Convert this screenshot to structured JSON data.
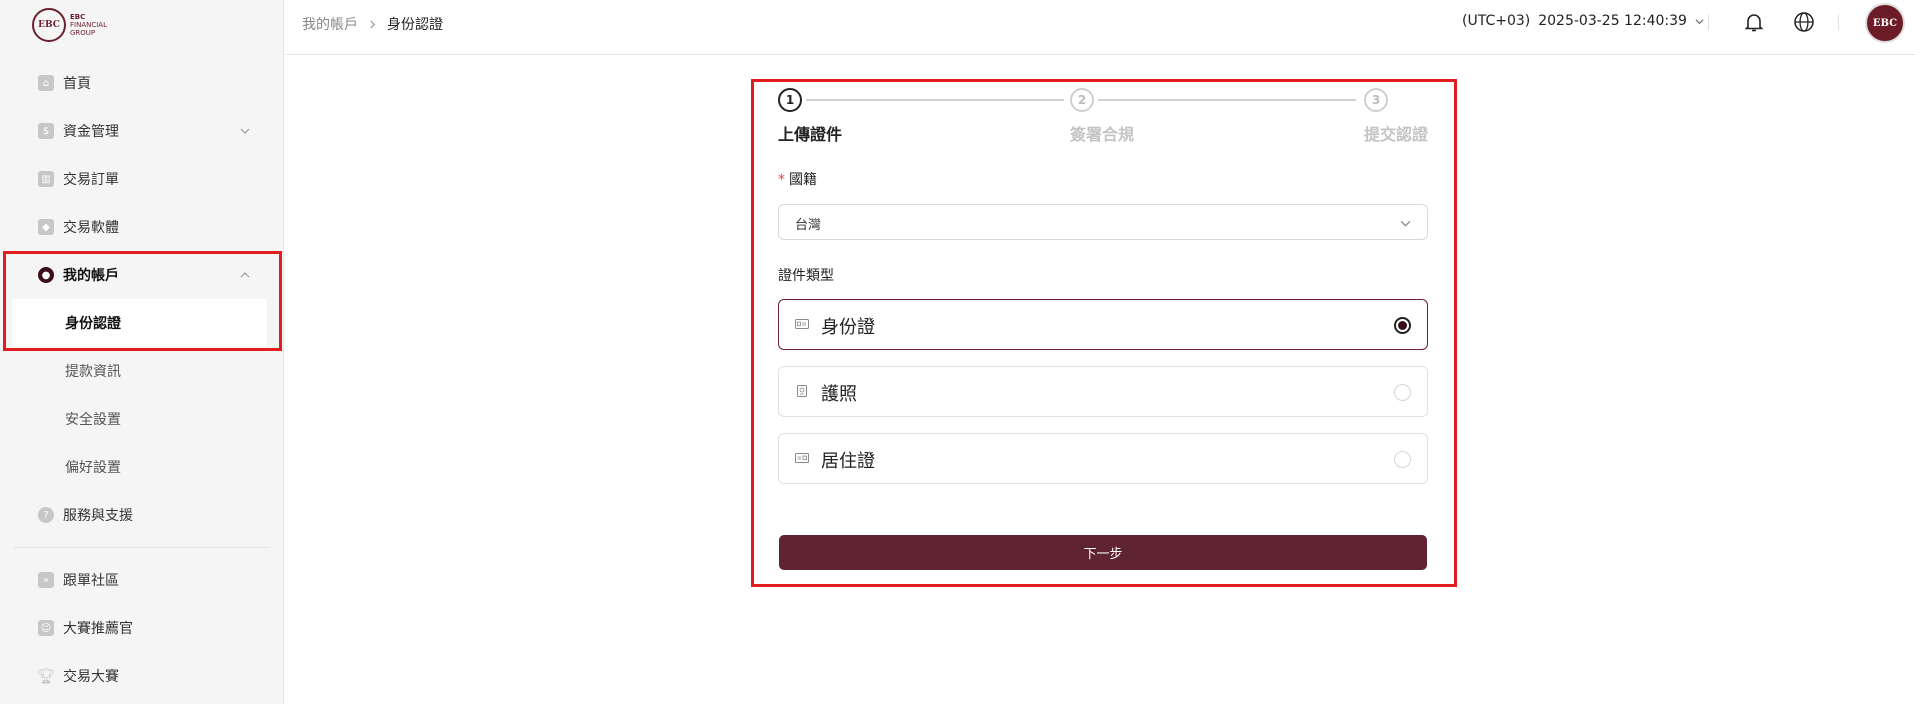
{
  "brand": {
    "short": "EBC",
    "line1": "EBC",
    "line2": "FINANCIAL",
    "line3": "GROUP"
  },
  "sidebar": {
    "items": [
      {
        "label": "首頁"
      },
      {
        "label": "資金管理"
      },
      {
        "label": "交易訂單"
      },
      {
        "label": "交易軟體"
      },
      {
        "label": "我的帳戶"
      },
      {
        "label": "身份認證"
      },
      {
        "label": "提款資訊"
      },
      {
        "label": "安全設置"
      },
      {
        "label": "偏好設置"
      },
      {
        "label": "服務與支援"
      },
      {
        "label": "跟單社區"
      },
      {
        "label": "大賽推薦官"
      },
      {
        "label": "交易大賽"
      }
    ]
  },
  "header": {
    "breadcrumb_parent": "我的帳戶",
    "breadcrumb_current": "身份認證",
    "timezone": "(UTC+03)",
    "datetime": "2025-03-25 12:40:39"
  },
  "steps": [
    {
      "number": "1",
      "label": "上傳證件"
    },
    {
      "number": "2",
      "label": "簽署合規"
    },
    {
      "number": "3",
      "label": "提交認證"
    }
  ],
  "form": {
    "nationality_required": "*",
    "nationality_label": "國籍",
    "nationality_value": "台灣",
    "doc_type_label": "證件類型",
    "options": [
      {
        "label": "身份證",
        "selected": true
      },
      {
        "label": "護照",
        "selected": false
      },
      {
        "label": "居住證",
        "selected": false
      }
    ],
    "next_label": "下一步"
  },
  "colors": {
    "accent": "#5f2331",
    "highlight": "#e11d1d",
    "sidebar_bg": "#f5f5f5"
  }
}
